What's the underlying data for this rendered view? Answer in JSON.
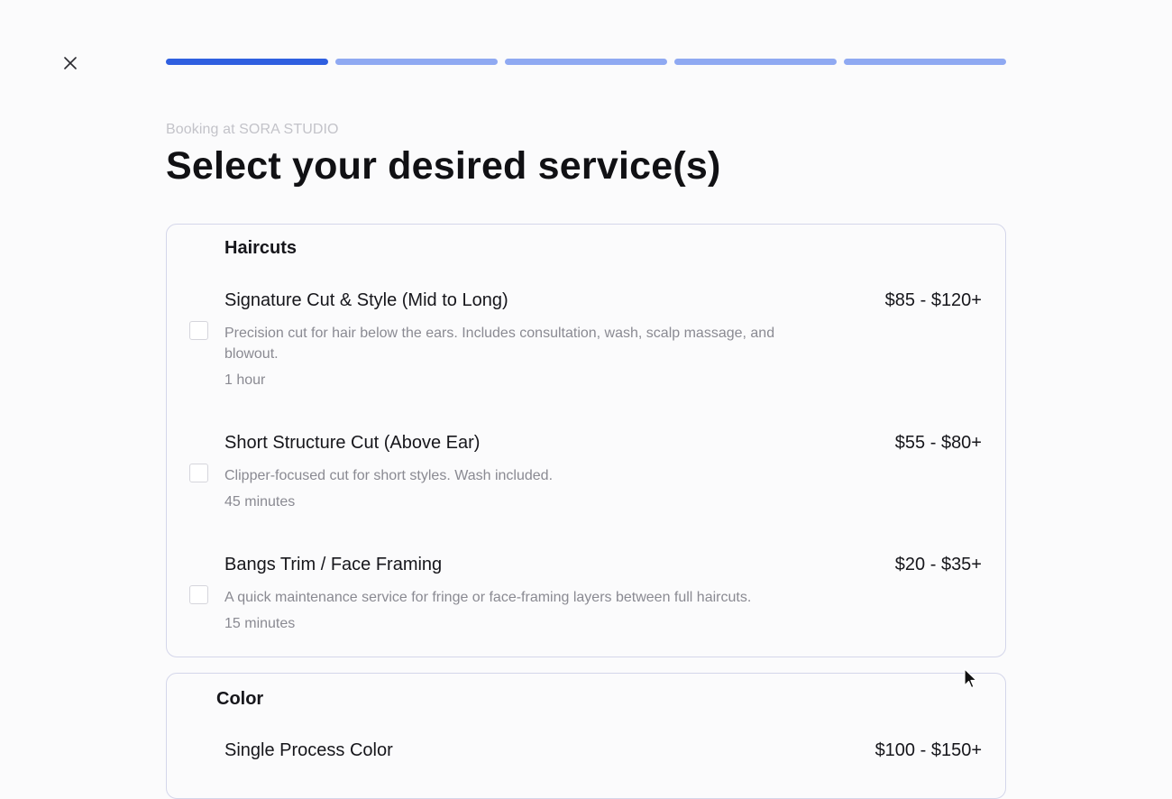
{
  "header": {
    "close_label": "close",
    "eyebrow": "Booking at SORA STUDIO",
    "title": "Select your desired service(s)"
  },
  "progress": {
    "total_steps": 5,
    "current_step": 1,
    "active_color": "#2f5fe0",
    "inactive_color": "#8fa9f2"
  },
  "categories": [
    {
      "title": "Haircuts",
      "services": [
        {
          "name": "Signature Cut & Style (Mid to Long)",
          "price": "$85 - $120+",
          "description": "Precision cut for hair below the ears. Includes consultation, wash, scalp massage, and blowout.",
          "duration": "1 hour",
          "checked": false
        },
        {
          "name": "Short Structure Cut (Above Ear)",
          "price": "$55 - $80+",
          "description": "Clipper-focused cut for short styles. Wash included.",
          "duration": "45 minutes",
          "checked": false
        },
        {
          "name": "Bangs Trim / Face Framing",
          "price": "$20 - $35+",
          "description": "A quick maintenance service for fringe or face-framing layers between full haircuts.",
          "duration": "15 minutes",
          "checked": false
        }
      ]
    },
    {
      "title": "Color",
      "services": [
        {
          "name": "Single Process Color",
          "price": "$100 - $150+"
        }
      ]
    }
  ],
  "icons": {
    "close": "close-icon",
    "cursor": "pointer-cursor-icon"
  }
}
